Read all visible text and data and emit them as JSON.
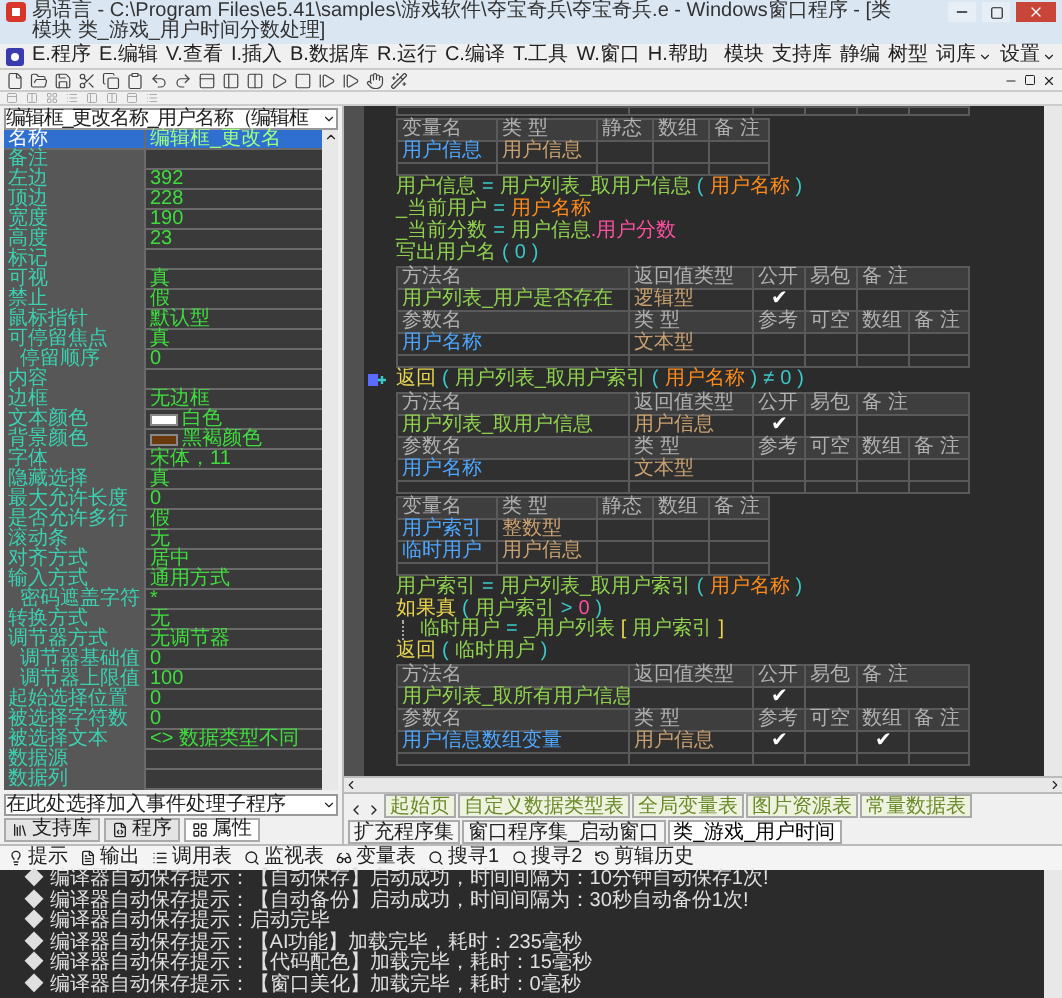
{
  "window": {
    "title": "易语言 - C:\\Program Files\\e5.41\\samples\\游戏软件\\夺宝奇兵\\夺宝奇兵.e - Windows窗口程序 - [类模块 类_游戏_用户时间分数处理]"
  },
  "menu": [
    "E.程序",
    "E.编辑",
    "V.查看",
    "I.插入",
    "B.数据库",
    "R.运行",
    "C.编译",
    "T.工具",
    "W.窗口",
    "H.帮助"
  ],
  "menu_right": [
    {
      "label": "模块",
      "dropdown": false
    },
    {
      "label": "支持库",
      "dropdown": false
    },
    {
      "label": "静编",
      "dropdown": false
    },
    {
      "label": "树型",
      "dropdown": false
    },
    {
      "label": "词库",
      "dropdown": true
    },
    {
      "label": "设置",
      "dropdown": true
    }
  ],
  "properties": {
    "object": "编辑框_更改名称_用户名称（编辑框",
    "rows": [
      {
        "name": "名称",
        "value": "编辑框_更改名",
        "selected": true
      },
      {
        "name": "备注",
        "selected": false
      },
      {
        "name": "左边",
        "value": "392",
        "selected": false
      },
      {
        "name": "顶边",
        "value": "228",
        "selected": false
      },
      {
        "name": "宽度",
        "value": "190",
        "selected": false
      },
      {
        "name": "高度",
        "value": "23",
        "selected": false
      },
      {
        "name": "标记",
        "selected": false
      },
      {
        "name": "可视",
        "value": "真",
        "selected": false
      },
      {
        "name": "禁止",
        "value": "假",
        "selected": false
      },
      {
        "name": "鼠标指针",
        "value": "默认型",
        "selected": false
      },
      {
        "name": "可停留焦点",
        "value": "真",
        "selected": false,
        "children": [
          {
            "name": "停留顺序",
            "value": "0",
            "selected": false
          }
        ]
      },
      {
        "name": "内容",
        "selected": false
      },
      {
        "name": "边框",
        "value": "无边框",
        "selected": false
      },
      {
        "name": "文本颜色",
        "value": "白色",
        "color": "#ffffff",
        "selected": false
      },
      {
        "name": "背景颜色",
        "value": "黑褐颜色",
        "color": "#6b3a0c",
        "selected": false
      },
      {
        "name": "字体",
        "value": "宋体，11",
        "selected": false
      },
      {
        "name": "隐藏选择",
        "value": "真",
        "selected": false
      },
      {
        "name": "最大允许长度",
        "value": "0",
        "selected": false
      },
      {
        "name": "是否允许多行",
        "value": "假",
        "selected": false
      },
      {
        "name": "滚动条",
        "value": "无",
        "selected": false
      },
      {
        "name": "对齐方式",
        "value": "居中",
        "selected": false
      },
      {
        "name": "输入方式",
        "value": "通用方式",
        "selected": false,
        "children": [
          {
            "name": "密码遮盖字符",
            "value": "*",
            "selected": false
          }
        ]
      },
      {
        "name": "转换方式",
        "value": "无",
        "selected": false
      },
      {
        "name": "调节器方式",
        "value": "无调节器",
        "selected": false,
        "children": [
          {
            "name": "调节器基础值",
            "value": "0",
            "selected": false
          },
          {
            "name": "调节器上限值",
            "value": "100",
            "selected": false
          }
        ]
      },
      {
        "name": "起始选择位置",
        "value": "0",
        "selected": false
      },
      {
        "name": "被选择字符数",
        "value": "0",
        "selected": false
      },
      {
        "name": "被选择文本",
        "value": "<> 数据类型不同",
        "selected": false
      },
      {
        "name": "数据源",
        "selected": false
      },
      {
        "name": "数据列",
        "selected": false
      }
    ],
    "event_box": "在此处选择加入事件处理子程序",
    "tabs": [
      {
        "label": "支持库",
        "selected": false
      },
      {
        "label": "程序",
        "selected": false
      },
      {
        "label": "属性",
        "selected": true
      }
    ]
  },
  "code": [
    {
      "kind": "method_table",
      "rows": [
        {
          "cells": [
            {},
            {},
            {},
            {},
            {},
            {}
          ]
        }
      ]
    },
    {
      "kind": "variable_table",
      "rows": [
        {
          "cells": [
            {
              "text": "变量名",
              "kind": "head"
            },
            {
              "text": "类 型",
              "kind": "head"
            },
            {
              "text": "静态",
              "kind": "head"
            },
            {
              "text": "数组",
              "kind": "head"
            },
            {
              "text": "备 注",
              "kind": "head"
            }
          ]
        },
        {
          "cells": [
            {
              "text": "用户信息",
              "kind": "var"
            },
            {
              "text": "用户信息",
              "kind": "type"
            },
            {},
            {},
            {}
          ]
        },
        {
          "cells": [
            {},
            {},
            {},
            {},
            {}
          ]
        }
      ]
    },
    {
      "kind": "line",
      "flag": false,
      "tokens": [
        {
          "text": "用户信息",
          "kind": "method"
        },
        {
          "text": "=",
          "kind": "op"
        },
        {
          "text": "用户列表_取用户信息",
          "kind": "method"
        },
        {
          "text": "(",
          "kind": "op"
        },
        {
          "text": "用户名称",
          "kind": "param"
        },
        {
          "text": ")",
          "kind": "op"
        }
      ]
    },
    {
      "kind": "line",
      "flag": false,
      "tokens": [
        {
          "text": "_当前用户",
          "kind": "method"
        },
        {
          "text": "=",
          "kind": "op"
        },
        {
          "text": "用户名称",
          "kind": "param"
        }
      ]
    },
    {
      "kind": "line",
      "flag": false,
      "tokens": [
        {
          "text": "_当前分数",
          "kind": "method"
        },
        {
          "text": "=",
          "kind": "op"
        },
        {
          "text": "用户信息",
          "kind": "method"
        },
        {
          "text": ".用户分数",
          "kind": "member"
        }
      ]
    },
    {
      "kind": "line",
      "flag": false,
      "tokens": [
        {
          "text": "写出用户名",
          "kind": "method"
        },
        {
          "text": "(",
          "kind": "op"
        },
        {
          "text": "0",
          "kind": "op"
        },
        {
          "text": ")",
          "kind": "op"
        }
      ]
    },
    {
      "kind": "method_table",
      "rows": [
        {
          "cells": [
            {
              "text": "方法名",
              "kind": "head"
            },
            {
              "text": "返回值类型",
              "kind": "head"
            },
            {
              "text": "公开",
              "kind": "head"
            },
            {
              "text": "易包",
              "kind": "head"
            },
            {
              "text": "备 注",
              "kind": "head"
            }
          ]
        },
        {
          "cells": [
            {
              "text": "用户列表_用户是否存在",
              "kind": "method"
            },
            {
              "text": "逻辑型",
              "kind": "type"
            },
            {
              "text": "✔",
              "kind": "check"
            },
            {},
            {}
          ]
        },
        {
          "cells": [
            {
              "text": "参数名",
              "kind": "head"
            },
            {
              "text": "类 型",
              "kind": "head"
            },
            {
              "text": "参考",
              "kind": "head"
            },
            {
              "text": "可空",
              "kind": "head"
            },
            {
              "text": "数组",
              "kind": "head"
            },
            {
              "text": "备 注",
              "kind": "head"
            }
          ]
        },
        {
          "cells": [
            {
              "text": "用户名称",
              "kind": "var"
            },
            {
              "text": "文本型",
              "kind": "type"
            },
            {},
            {},
            {},
            {}
          ]
        },
        {
          "cells": [
            {},
            {},
            {},
            {},
            {},
            {}
          ]
        }
      ]
    },
    {
      "kind": "line",
      "flag": true,
      "tokens": [
        {
          "text": "返回",
          "kind": "keyword"
        },
        {
          "text": "(",
          "kind": "op"
        },
        {
          "text": "用户列表_取用户索引",
          "kind": "method"
        },
        {
          "text": "(",
          "kind": "op"
        },
        {
          "text": "用户名称",
          "kind": "param"
        },
        {
          "text": ")",
          "kind": "op"
        },
        {
          "text": "≠",
          "kind": "op"
        },
        {
          "text": "0",
          "kind": "op"
        },
        {
          "text": ")",
          "kind": "op"
        }
      ]
    },
    {
      "kind": "method_table",
      "rows": [
        {
          "cells": [
            {
              "text": "方法名",
              "kind": "head"
            },
            {
              "text": "返回值类型",
              "kind": "head"
            },
            {
              "text": "公开",
              "kind": "head"
            },
            {
              "text": "易包",
              "kind": "head"
            },
            {
              "text": "备 注",
              "kind": "head"
            }
          ]
        },
        {
          "cells": [
            {
              "text": "用户列表_取用户信息",
              "kind": "method"
            },
            {
              "text": "用户信息",
              "kind": "type"
            },
            {
              "text": "✔",
              "kind": "check"
            },
            {},
            {}
          ]
        },
        {
          "cells": [
            {
              "text": "参数名",
              "kind": "head"
            },
            {
              "text": "类 型",
              "kind": "head"
            },
            {
              "text": "参考",
              "kind": "head"
            },
            {
              "text": "可空",
              "kind": "head"
            },
            {
              "text": "数组",
              "kind": "head"
            },
            {
              "text": "备 注",
              "kind": "head"
            }
          ]
        },
        {
          "cells": [
            {
              "text": "用户名称",
              "kind": "var"
            },
            {
              "text": "文本型",
              "kind": "type"
            },
            {},
            {},
            {},
            {}
          ]
        },
        {
          "cells": [
            {},
            {},
            {},
            {},
            {},
            {}
          ]
        }
      ]
    },
    {
      "kind": "variable_table",
      "rows": [
        {
          "cells": [
            {
              "text": "变量名",
              "kind": "head"
            },
            {
              "text": "类 型",
              "kind": "head"
            },
            {
              "text": "静态",
              "kind": "head"
            },
            {
              "text": "数组",
              "kind": "head"
            },
            {
              "text": "备 注",
              "kind": "head"
            }
          ]
        },
        {
          "cells": [
            {
              "text": "用户索引",
              "kind": "var"
            },
            {
              "text": "整数型",
              "kind": "type"
            },
            {},
            {},
            {}
          ]
        },
        {
          "cells": [
            {
              "text": "临时用户",
              "kind": "var"
            },
            {
              "text": "用户信息",
              "kind": "type"
            },
            {},
            {},
            {}
          ]
        },
        {
          "cells": [
            {},
            {},
            {},
            {},
            {}
          ]
        }
      ]
    },
    {
      "kind": "line",
      "flag": false,
      "tokens": [
        {
          "text": "用户索引",
          "kind": "method"
        },
        {
          "text": "=",
          "kind": "op"
        },
        {
          "text": "用户列表_取用户索引",
          "kind": "method"
        },
        {
          "text": "(",
          "kind": "op"
        },
        {
          "text": "用户名称",
          "kind": "param"
        },
        {
          "text": ")",
          "kind": "op"
        }
      ]
    },
    {
      "kind": "line",
      "flag": false,
      "tokens": [
        {
          "text": "如果真",
          "kind": "keyword"
        },
        {
          "text": "(",
          "kind": "op"
        },
        {
          "text": "用户索引",
          "kind": "method"
        },
        {
          "text": ">",
          "kind": "op"
        },
        {
          "text": "0",
          "kind": "number"
        },
        {
          "text": ")",
          "kind": "op"
        }
      ],
      "children": [
        {
          "kind": "line",
          "flag": false,
          "tokens": [
            {
              "text": "临时用户",
              "kind": "method"
            },
            {
              "text": "=",
              "kind": "op"
            },
            {
              "text": "_用户列表",
              "kind": "method"
            },
            {
              "text": "[",
              "kind": "keyword"
            },
            {
              "text": "用户索引",
              "kind": "method"
            },
            {
              "text": "]",
              "kind": "keyword"
            }
          ]
        }
      ]
    },
    {
      "kind": "line",
      "flag": false,
      "tokens": [
        {
          "text": "返回",
          "kind": "keyword"
        },
        {
          "text": "(",
          "kind": "op"
        },
        {
          "text": "临时用户",
          "kind": "method"
        },
        {
          "text": ")",
          "kind": "op"
        }
      ]
    },
    {
      "kind": "method_table",
      "rows": [
        {
          "cells": [
            {
              "text": "方法名",
              "kind": "head"
            },
            {
              "text": "返回值类型",
              "kind": "head"
            },
            {
              "text": "公开",
              "kind": "head"
            },
            {
              "text": "易包",
              "kind": "head"
            },
            {
              "text": "备 注",
              "kind": "head"
            }
          ]
        },
        {
          "cells": [
            {
              "text": "用户列表_取所有用户信息",
              "kind": "method"
            },
            {},
            {
              "text": "✔",
              "kind": "check"
            },
            {},
            {}
          ]
        },
        {
          "cells": [
            {
              "text": "参数名",
              "kind": "head"
            },
            {
              "text": "类 型",
              "kind": "head"
            },
            {
              "text": "参考",
              "kind": "head"
            },
            {
              "text": "可空",
              "kind": "head"
            },
            {
              "text": "数组",
              "kind": "head"
            },
            {
              "text": "备 注",
              "kind": "head"
            }
          ]
        },
        {
          "cells": [
            {
              "text": "用户信息数组变量",
              "kind": "var"
            },
            {
              "text": "用户信息",
              "kind": "type"
            },
            {
              "text": "✔",
              "kind": "check"
            },
            {},
            {
              "text": "✔",
              "kind": "check"
            },
            {}
          ]
        },
        {
          "cells": [
            {},
            {},
            {},
            {},
            {},
            {}
          ]
        }
      ]
    }
  ],
  "editor_tabs": [
    {
      "label": "起始页",
      "selected": false
    },
    {
      "label": "自定义数据类型表",
      "selected": false
    },
    {
      "label": "全局变量表",
      "selected": false
    },
    {
      "label": "图片资源表",
      "selected": false
    },
    {
      "label": "常量数据表",
      "selected": false
    },
    {
      "label": "扩充程序集",
      "selected": false
    },
    {
      "label": "窗口程序集_启动窗口",
      "selected": false
    },
    {
      "label": "类_游戏_用户时间",
      "selected": true
    }
  ],
  "output_tabs": [
    {
      "label": "提示",
      "kind": "tip"
    },
    {
      "label": "输出",
      "kind": "output"
    },
    {
      "label": "调用表",
      "kind": "calls"
    },
    {
      "label": "监视表",
      "kind": "watch"
    },
    {
      "label": "变量表",
      "kind": "vars"
    },
    {
      "label": "搜寻1",
      "kind": "find"
    },
    {
      "label": "搜寻2",
      "kind": "find"
    },
    {
      "label": "剪辑历史",
      "kind": "history"
    }
  ],
  "output_lines": [
    "◆ 编译器自动保存提示：【自动保存】启动成功，时间间隔为：10分钟自动保存1次!",
    "◆ 编译器自动保存提示：【自动备份】启动成功，时间间隔为：30秒自动备份1次!",
    "◆ 编译器自动保存提示：启动完毕",
    "◆ 编译器自动保存提示：【AI功能】加载完毕，耗时：235毫秒",
    "◆ 编译器自动保存提示：【代码配色】加载完毕，耗时：15毫秒",
    "◆ 编译器自动保存提示：【窗口美化】加载完毕，耗时：0毫秒"
  ]
}
